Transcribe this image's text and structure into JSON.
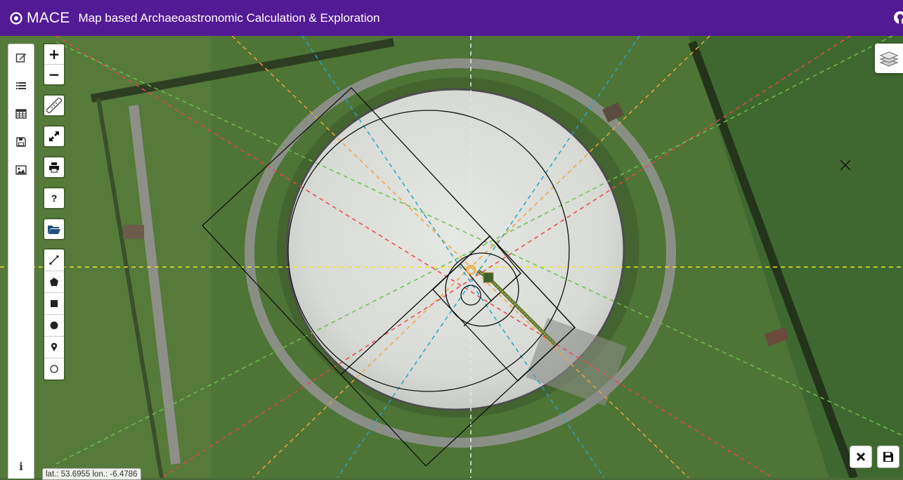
{
  "app": {
    "name": "MACE",
    "subtitle": "Map based Archaeoastronomic Calculation & Exploration",
    "brand_color": "#531a96"
  },
  "sidebar": {
    "items": [
      {
        "icon": "edit-icon"
      },
      {
        "icon": "list-icon"
      },
      {
        "icon": "table-icon"
      },
      {
        "icon": "save-icon"
      },
      {
        "icon": "image-icon"
      }
    ],
    "info_label": "i"
  },
  "zoom": {
    "in_label": "+",
    "out_label": "−"
  },
  "tools": [
    {
      "icon": "ruler-icon"
    },
    {
      "icon": "fullscreen-icon"
    },
    {
      "icon": "print-icon"
    },
    {
      "icon": "help-icon",
      "label": "?"
    },
    {
      "icon": "folder-open-icon"
    }
  ],
  "draw_tools": [
    {
      "icon": "draw-polyline-icon"
    },
    {
      "icon": "draw-polygon-icon"
    },
    {
      "icon": "draw-rectangle-icon"
    },
    {
      "icon": "draw-circle-icon"
    },
    {
      "icon": "draw-marker-icon"
    },
    {
      "icon": "draw-circlemarker-icon"
    }
  ],
  "status": {
    "coordinates": "lat.: 53.6955 lon.: -6.4786"
  },
  "map_overlay": {
    "line_colors": {
      "red": "#e8484a",
      "orange": "#f0a33a",
      "green": "#6cc04a",
      "blue": "#2aa3c8",
      "yellow": "#f2e12a",
      "white": "#e8e8e8"
    }
  },
  "bottom_right": {
    "close_icon": "close-icon",
    "save_icon": "save-icon"
  }
}
